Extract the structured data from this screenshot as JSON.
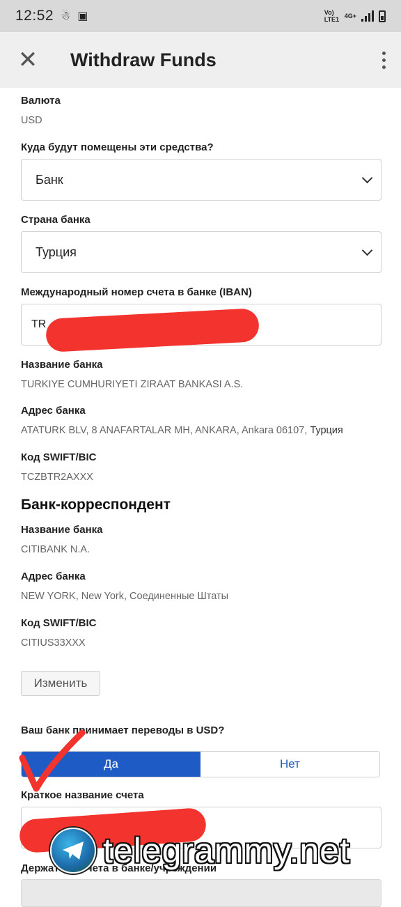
{
  "status_bar": {
    "time": "12:52",
    "network": "Vo) LTE1",
    "network_type": "4G+"
  },
  "app_bar": {
    "title": "Withdraw Funds",
    "close_icon": "close-icon",
    "more_icon": "more-vert-icon"
  },
  "form": {
    "currency": {
      "label": "Валюта",
      "value": "USD"
    },
    "destination": {
      "label": "Куда будут помещены эти средства?",
      "selected": "Банк"
    },
    "bank_country": {
      "label": "Страна банка",
      "selected": "Турция"
    },
    "iban": {
      "label": "Международный номер счета в банке (IBAN)",
      "value": "TR"
    },
    "bank_name": {
      "label": "Название банка",
      "value": "TURKIYE CUMHURIYETI ZIRAAT BANKASI A.S."
    },
    "bank_address": {
      "label": "Адрес банка",
      "value": "ATATURK BLV, 8 ANAFARTALAR MH, ANKARA, Ankara 06107, ",
      "country": "Турция"
    },
    "swift": {
      "label": "Код SWIFT/BIC",
      "value": "TCZBTR2AXXX"
    },
    "correspondent": {
      "heading": "Банк-корреспондент",
      "bank_name": {
        "label": "Название банка",
        "value": "CITIBANK N.A."
      },
      "bank_address": {
        "label": "Адрес банка",
        "value": "NEW YORK, New York, Соединенные Штаты"
      },
      "swift": {
        "label": "Код SWIFT/BIC",
        "value": "CITIUS33XXX"
      },
      "change_button": "Изменить"
    },
    "accepts_usd": {
      "label": "Ваш банк принимает переводы в USD?",
      "yes": "Да",
      "no": "Нет",
      "selected": "yes"
    },
    "short_name": {
      "label": "Краткое название счета",
      "value": ""
    },
    "holder": {
      "label": "Держатель счета в банке/учреждении"
    }
  },
  "watermark": {
    "text": "telegrammy.net"
  },
  "colors": {
    "accent": "#1f5bc4",
    "redaction": "#f2332e",
    "app_bar": "#efefef",
    "status_bar": "#d9d9d9"
  }
}
